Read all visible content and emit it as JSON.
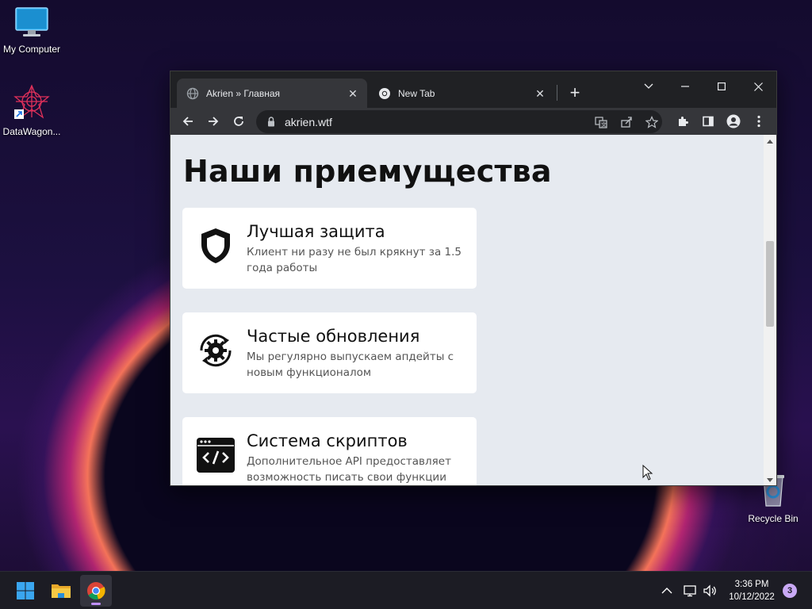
{
  "desktop": {
    "icons": [
      {
        "label": "My Computer",
        "icon": "monitor-icon"
      },
      {
        "label": "DataWagon...",
        "icon": "datawagon-icon"
      },
      {
        "label": "Recycle Bin",
        "icon": "recycle-bin-icon"
      }
    ]
  },
  "browser": {
    "tabs": [
      {
        "title": "Akrien » Главная",
        "icon": "globe-icon",
        "active": true
      },
      {
        "title": "New Tab",
        "icon": "chrome-icon",
        "active": false
      }
    ],
    "url": "akrien.wtf"
  },
  "page": {
    "heading": "Наши приемущества",
    "cards": [
      {
        "title": "Лучшая защита",
        "text": "Клиент ни разу не был крякнут за 1.5 года работы",
        "icon": "shield-icon"
      },
      {
        "title": "Частые обновления",
        "text": "Мы регулярно выпускаем апдейты с новым функционалом",
        "icon": "gear-sync-icon"
      },
      {
        "title": "Система скриптов",
        "text": "Дополнительное API предоставляет возможность писать свои функции",
        "icon": "code-window-icon"
      }
    ]
  },
  "taskbar": {
    "time": "3:36 PM",
    "date": "10/12/2022",
    "notifications": "3",
    "apps": [
      "windows-start-icon",
      "file-explorer-icon",
      "chrome-icon"
    ]
  }
}
